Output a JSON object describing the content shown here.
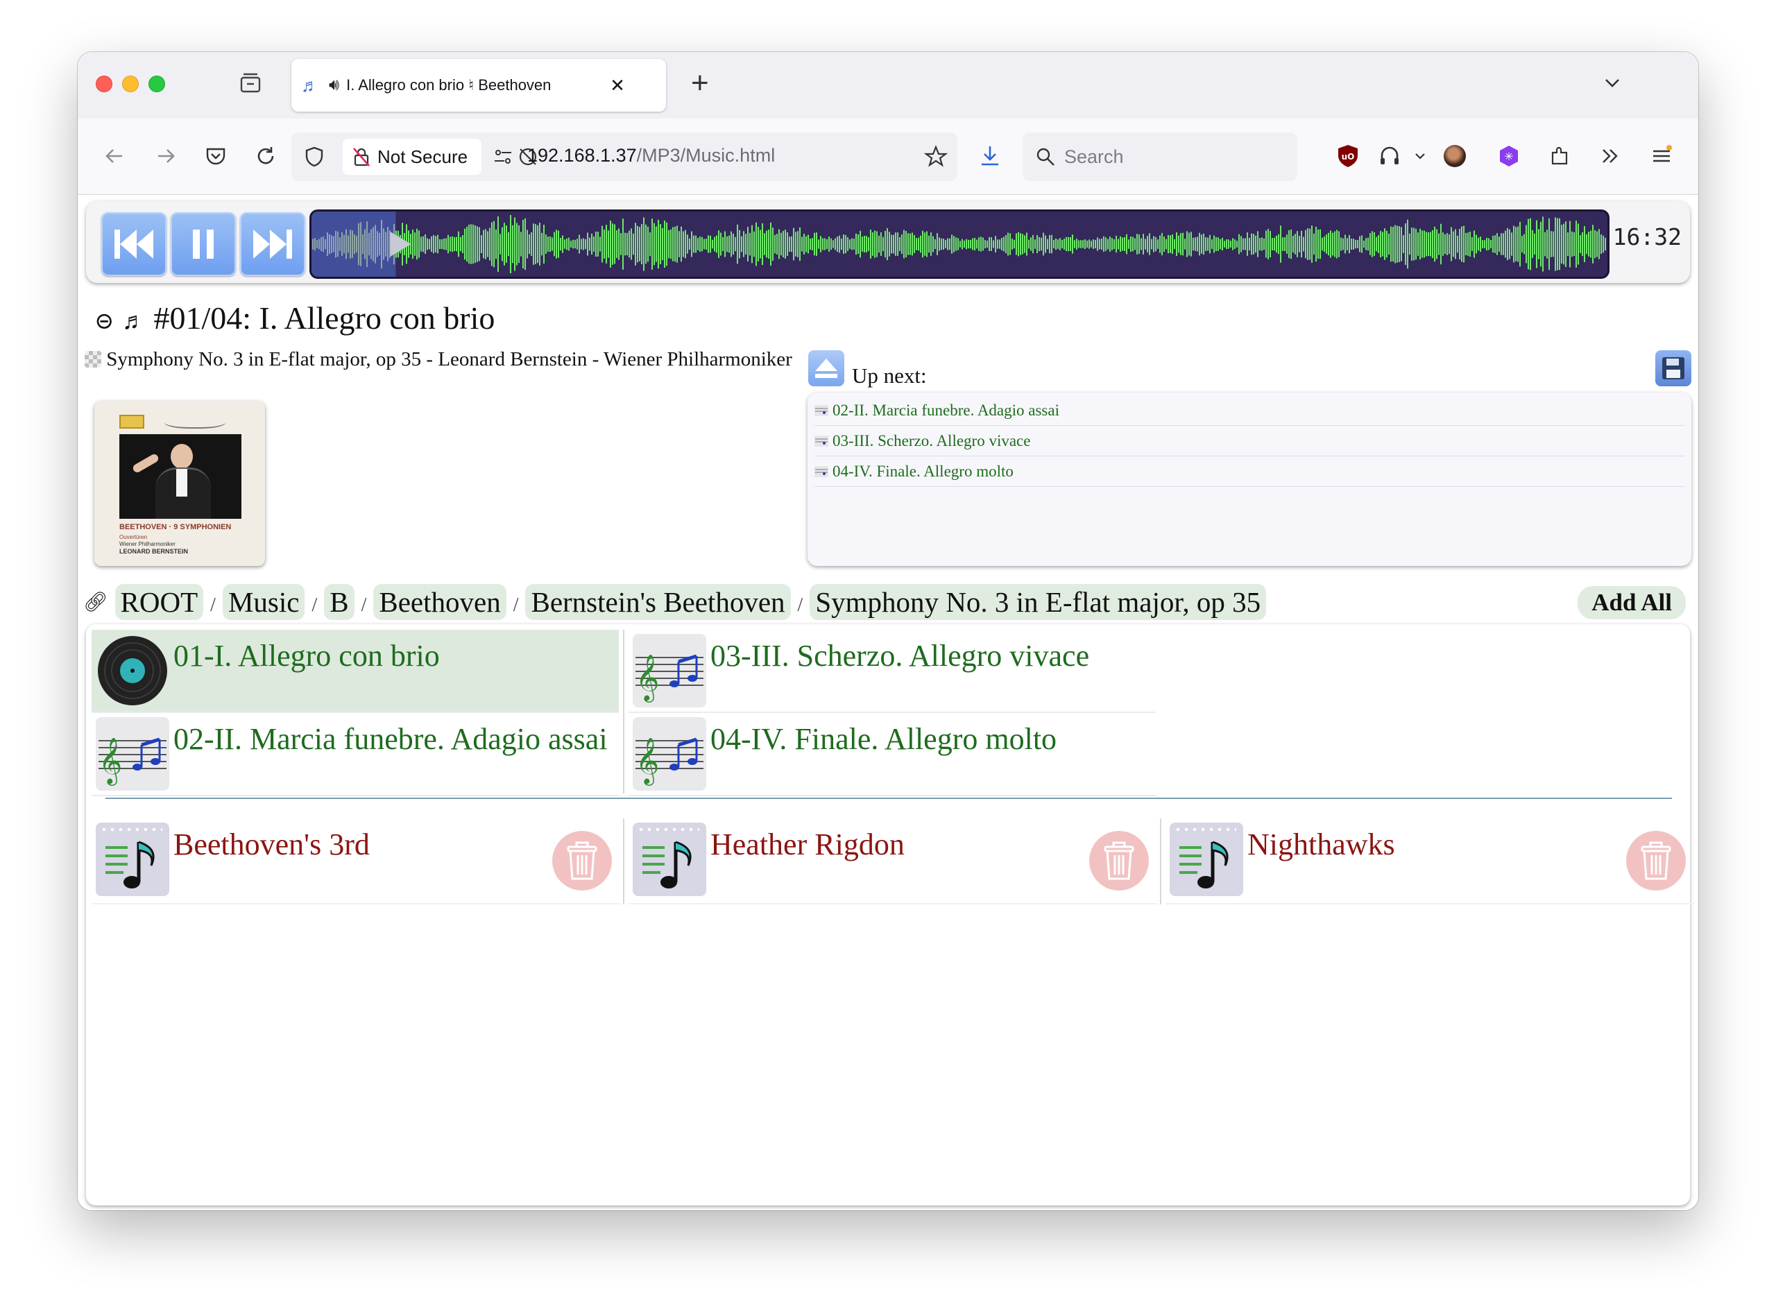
{
  "browser": {
    "tab_title": "I. Allegro con brio ♮ Beethoven",
    "security_label": "Not Secure",
    "url_host": "192.168.1.37",
    "url_path": "/MP3/Music.html",
    "search_placeholder": "Search"
  },
  "player": {
    "time": "16:32",
    "progress_fraction": 0.065,
    "waveform_color": "#6fe86a",
    "played_color": "#4d6fd0"
  },
  "now_playing": {
    "title": "#01/04: I. Allegro con brio",
    "album_line": "Symphony No. 3 in E-flat major, op 35 - Leonard Bernstein - Wiener Philharmoniker",
    "cover": {
      "line1": "BEETHOVEN · 9 SYMPHONIEN",
      "line2": "Ouvertüren",
      "line3": "Wiener Philharmoniker",
      "line4": "LEONARD BERNSTEIN"
    }
  },
  "up_next": {
    "label": "Up next:",
    "items": [
      "02-II. Marcia funebre. Adagio assai",
      "03-III. Scherzo. Allegro vivace",
      "04-IV. Finale. Allegro molto"
    ]
  },
  "breadcrumbs": [
    "ROOT",
    "Music",
    "B",
    "Beethoven",
    "Bernstein's Beethoven",
    "Symphony No. 3 in E-flat major, op 35"
  ],
  "breadcrumb_separator": "/",
  "add_all_label": "Add All",
  "tracks": [
    "01-I. Allegro con brio",
    "02-II. Marcia funebre. Adagio assai",
    "03-III. Scherzo. Allegro vivace",
    "04-IV. Finale. Allegro molto"
  ],
  "playlists": [
    "Beethoven's 3rd",
    "Heather Rigdon",
    "Nighthawks"
  ],
  "colors": {
    "track_text": "#1e6b1e",
    "playlist_text": "#8b1512",
    "playing_row": "#dde9dd"
  }
}
